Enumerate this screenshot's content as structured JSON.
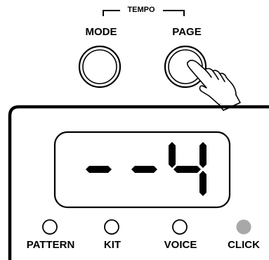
{
  "tempo_bracket": {
    "label": "TEMPO"
  },
  "buttons": {
    "mode": {
      "label": "MODE"
    },
    "page": {
      "label": "PAGE",
      "pressed": true
    }
  },
  "display": {
    "digits": [
      "-",
      "-",
      "4"
    ]
  },
  "indicators": [
    {
      "label": "PATTERN",
      "lit": false
    },
    {
      "label": "KIT",
      "lit": false
    },
    {
      "label": "VOICE",
      "lit": false
    },
    {
      "label": "CLICK",
      "lit": true
    }
  ],
  "colors": {
    "ink": "#000000",
    "lit_indicator": "#a8a8a8",
    "background": "#ffffff"
  },
  "icons": {
    "hand": "pointing-hand-icon"
  }
}
